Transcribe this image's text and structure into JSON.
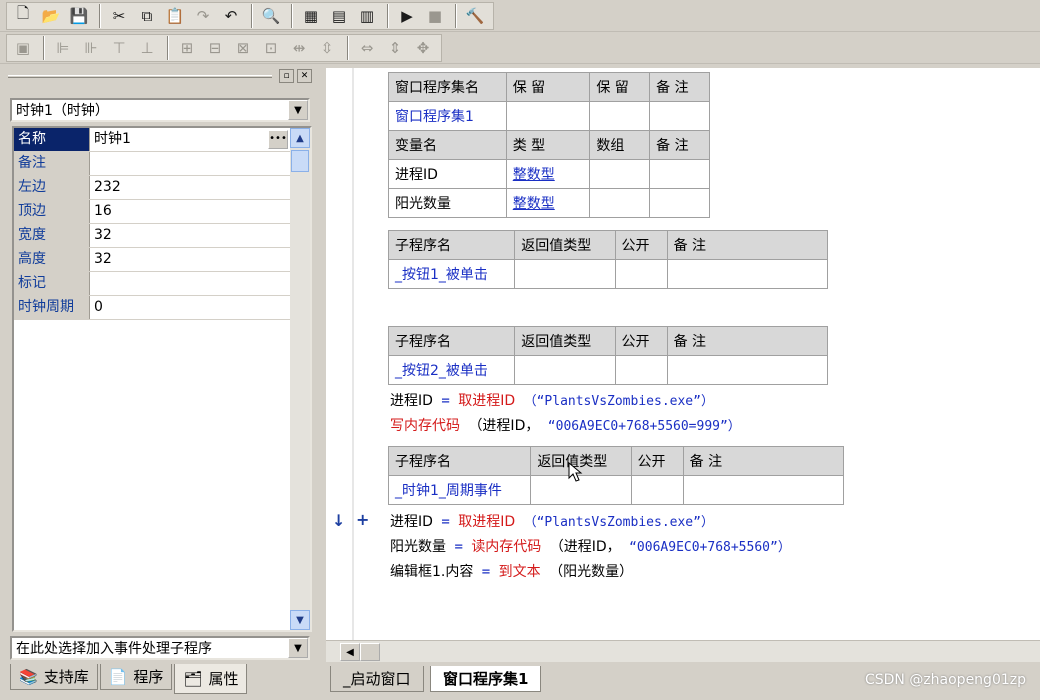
{
  "left_panel": {
    "object_selector": "时钟1（时钟）",
    "properties": [
      {
        "name": "名称",
        "value": "时钟1"
      },
      {
        "name": "备注",
        "value": ""
      },
      {
        "name": "左边",
        "value": "232"
      },
      {
        "name": "顶边",
        "value": "16"
      },
      {
        "name": "宽度",
        "value": "32"
      },
      {
        "name": "高度",
        "value": "32"
      },
      {
        "name": "标记",
        "value": ""
      },
      {
        "name": "时钟周期",
        "value": "0"
      }
    ],
    "event_selector": "在此处选择加入事件处理子程序",
    "tabs": [
      "支持库",
      "程序",
      "属性"
    ]
  },
  "assembly_table": {
    "header": [
      "窗口程序集名",
      "保 留",
      "保 留",
      "备 注"
    ],
    "row": [
      "窗口程序集1",
      "",
      "",
      ""
    ]
  },
  "var_table": {
    "header": [
      "变量名",
      "类 型",
      "数组",
      "备 注"
    ],
    "rows": [
      [
        "进程ID",
        "整数型",
        "",
        ""
      ],
      [
        "阳光数量",
        "整数型",
        "",
        ""
      ]
    ]
  },
  "sub1": {
    "header": [
      "子程序名",
      "返回值类型",
      "公开",
      "备 注"
    ],
    "name": "_按钮1_被单击"
  },
  "sub2": {
    "header": [
      "子程序名",
      "返回值类型",
      "公开",
      "备 注"
    ],
    "name": "_按钮2_被单击",
    "code": [
      {
        "lhs": "进程ID",
        "op": "=",
        "fn": "取进程ID",
        "args": "（“PlantsVsZombies.exe”）"
      },
      {
        "fn": "写内存代码",
        "args1": "（进程ID，",
        "str": "“006A9EC0+768+5560=999”）"
      }
    ]
  },
  "sub3": {
    "header": [
      "子程序名",
      "返回值类型",
      "公开",
      "备 注"
    ],
    "name": "_时钟1_周期事件",
    "code": [
      {
        "lhs": "进程ID",
        "op": "=",
        "fn": "取进程ID",
        "args": "（“PlantsVsZombies.exe”）"
      },
      {
        "lhs": "阳光数量",
        "op": "=",
        "fn": "读内存代码",
        "args1": "（进程ID，",
        "str": "“006A9EC0+768+5560”）"
      },
      {
        "lhs": "编辑框1.内容",
        "op": "=",
        "fn": "到文本",
        "args": "（阳光数量）"
      }
    ]
  },
  "editor_tabs": [
    "_启动窗口",
    "窗口程序集1"
  ],
  "watermark": "CSDN @zhaopeng01zp"
}
